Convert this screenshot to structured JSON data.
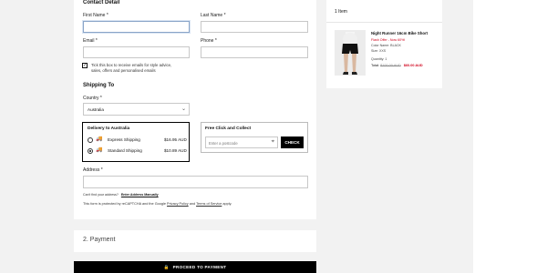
{
  "contact": {
    "title": "Contact Detail",
    "first_name_label": "First Name",
    "last_name_label": "Last Name",
    "email_label": "Email",
    "phone_label": "Phone",
    "required": "*",
    "marketing_label_line1": "Tick this box to receive emails for style advice,",
    "marketing_label_line2": "sales, offers and personalised emails",
    "marketing_checked": true
  },
  "shipping": {
    "title": "Shipping To",
    "country_label": "Country",
    "country_value": "Australia",
    "delivery_title": "Delivery to Australia",
    "options": [
      {
        "label": "Express Shipping",
        "price": "$16.95 AUD",
        "selected": false
      },
      {
        "label": "Standard Shipping",
        "price": "$10.89 AUD",
        "selected": true
      }
    ],
    "click_title": "Free Click and Collect",
    "click_placeholder": "Enter a postcode",
    "check_label": "CHECK",
    "address_label": "Address",
    "cant_find": "Can't find your address?",
    "enter_manually": "Enter Address Manually",
    "recaptcha_prefix": "This form is protected by reCAPTCHA and the Google",
    "privacy": "Privacy Policy",
    "and": "and",
    "terms": "Terms of Service",
    "apply": "apply."
  },
  "payment": {
    "title": "2. Payment",
    "cta_label": "PROCEED TO PAYMENT"
  },
  "cart": {
    "count_label": "1 Item",
    "item": {
      "name": "Night Runner 16cm Bike Short",
      "promo": "Flash Offer - Now 60%!",
      "colour": "Color Name: BLACK",
      "size": "Size: XXS",
      "quantity": "Quantity: 1",
      "total_label": "Total:",
      "old_price": "$100.00 AUD",
      "new_price": "$60.00 AUD"
    }
  }
}
